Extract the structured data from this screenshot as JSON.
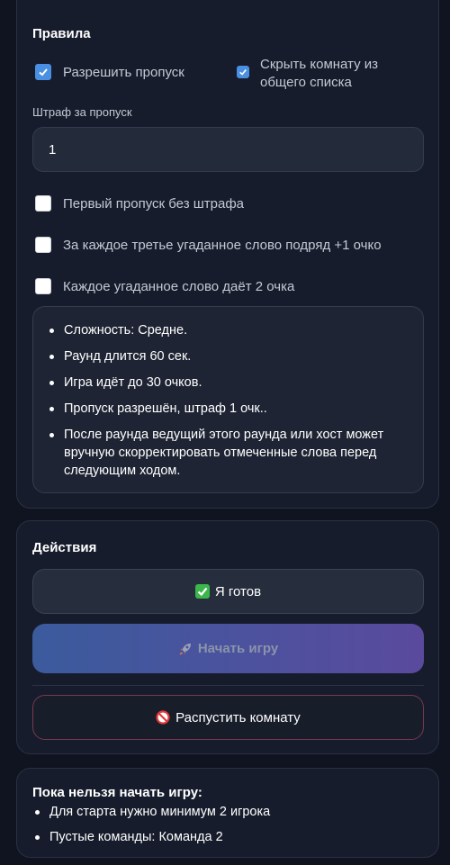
{
  "rules": {
    "title": "Правила",
    "allow_skip": {
      "label": "Разрешить пропуск",
      "checked": true
    },
    "hide_room": {
      "label": "Скрыть комнату из общего списка",
      "checked": true
    },
    "penalty": {
      "label": "Штраф за пропуск",
      "value": "1"
    },
    "options": [
      {
        "label": "Первый пропуск без штрафа",
        "checked": false
      },
      {
        "label": "За каждое третье угаданное слово подряд +1 очко",
        "checked": false
      },
      {
        "label": "Каждое угаданное слово даёт 2 очка",
        "checked": false
      }
    ],
    "summary": [
      "Сложность: Средне.",
      "Раунд длится 60 сек.",
      "Игра идёт до 30 очков.",
      "Пропуск разрешён, штраф 1 очк..",
      "После раунда ведущий этого раунда или хост может вручную скорректировать отмеченные слова перед следующим ходом."
    ]
  },
  "actions": {
    "title": "Действия",
    "ready_label": "Я готов",
    "start_label": "Начать игру",
    "disband_label": "Распустить комнату"
  },
  "notice": {
    "title": "Пока нельзя начать игру:",
    "items": [
      "Для старта нужно минимум 2 игрока",
      "Пустые команды: Команда 2"
    ]
  },
  "colors": {
    "background": "#0f1420",
    "card": "#161c2b",
    "accent_checkbox": "#4a90e2",
    "start_gradient": [
      "#3b5b9d",
      "#5a4a9e"
    ],
    "disband_border": "#7a3850"
  }
}
